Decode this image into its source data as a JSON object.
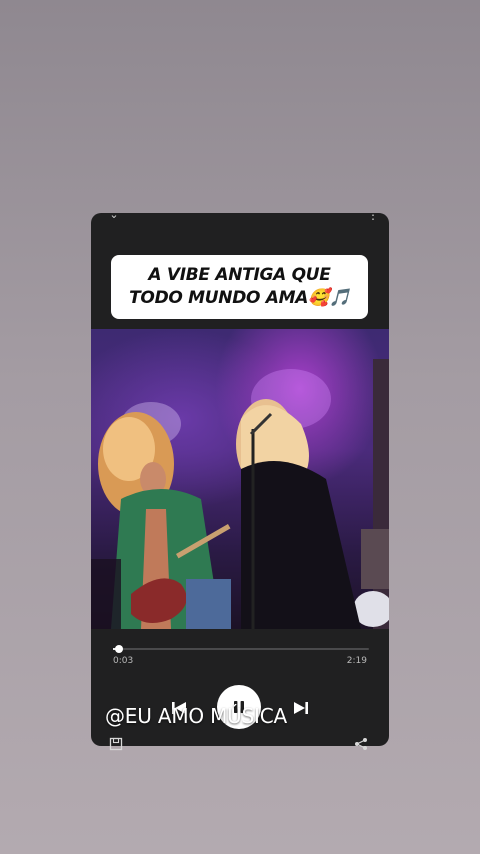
{
  "story": {
    "caption": "A VIBE ANTIGA QUE TODO MUNDO AMA🥰🎵",
    "watermark": "@EU AMO MÚSICA"
  },
  "player": {
    "current_time": "0:03",
    "total_time": "2:19",
    "progress_fraction": 0.022,
    "state": "playing"
  },
  "icons": {
    "collapse": "chevron-down-icon",
    "more": "more-vertical-icon",
    "prev": "skip-previous-icon",
    "pause": "pause-icon",
    "next": "skip-next-icon",
    "save": "save-icon",
    "share": "share-icon"
  },
  "colors": {
    "background": "#a29aa1",
    "card": "#202021",
    "caption_bg": "#ffffff",
    "accent": "#ffffff"
  }
}
